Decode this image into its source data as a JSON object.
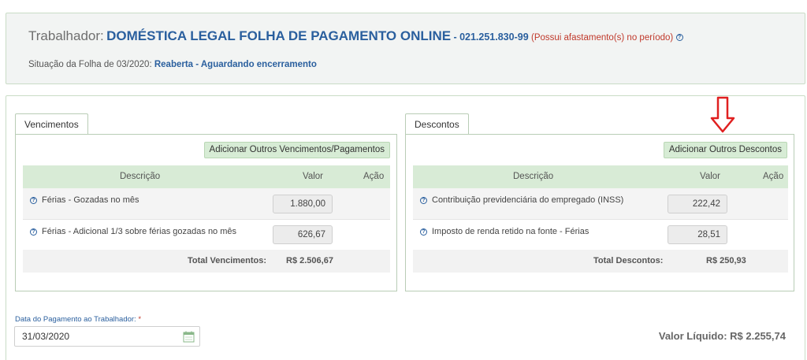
{
  "header": {
    "trabalhador_label": "Trabalhador:",
    "trabalhador_name": "DOMÉSTICA LEGAL FOLHA DE PAGAMENTO ONLINE",
    "cpf": "- 021.251.830-99",
    "afastamento_note": "(Possui afastamento(s) no período)",
    "situacao_label": "Situação da Folha de 03/2020:",
    "situacao_value": "Reaberta - Aguardando encerramento"
  },
  "vencimentos": {
    "tab_label": "Vencimentos",
    "add_button": "Adicionar Outros Vencimentos/Pagamentos",
    "columns": {
      "descricao": "Descrição",
      "valor": "Valor",
      "acao": "Ação"
    },
    "rows": [
      {
        "descricao": "Férias - Gozadas no mês",
        "valor": "1.880,00"
      },
      {
        "descricao": "Férias - Adicional 1/3 sobre férias gozadas no mês",
        "valor": "626,67"
      }
    ],
    "total_label": "Total Vencimentos:",
    "total_value": "R$ 2.506,67"
  },
  "descontos": {
    "tab_label": "Descontos",
    "add_button": "Adicionar Outros Descontos",
    "columns": {
      "descricao": "Descrição",
      "valor": "Valor",
      "acao": "Ação"
    },
    "rows": [
      {
        "descricao": "Contribuição previdenciária do empregado (INSS)",
        "valor": "222,42"
      },
      {
        "descricao": "Imposto de renda retido na fonte - Férias",
        "valor": "28,51"
      }
    ],
    "total_label": "Total Descontos:",
    "total_value": "R$ 250,93"
  },
  "pagamento": {
    "label": "Data do Pagamento ao Trabalhador:",
    "required_mark": "*",
    "date_value": "31/03/2020"
  },
  "valor_liquido": "Valor Líquido: R$ 2.255,74",
  "colors": {
    "accent_blue": "#2a5f9e",
    "green_header": "#d8ebd6",
    "alert_red": "#c0392b",
    "annotation_arrow": "#e02020"
  }
}
